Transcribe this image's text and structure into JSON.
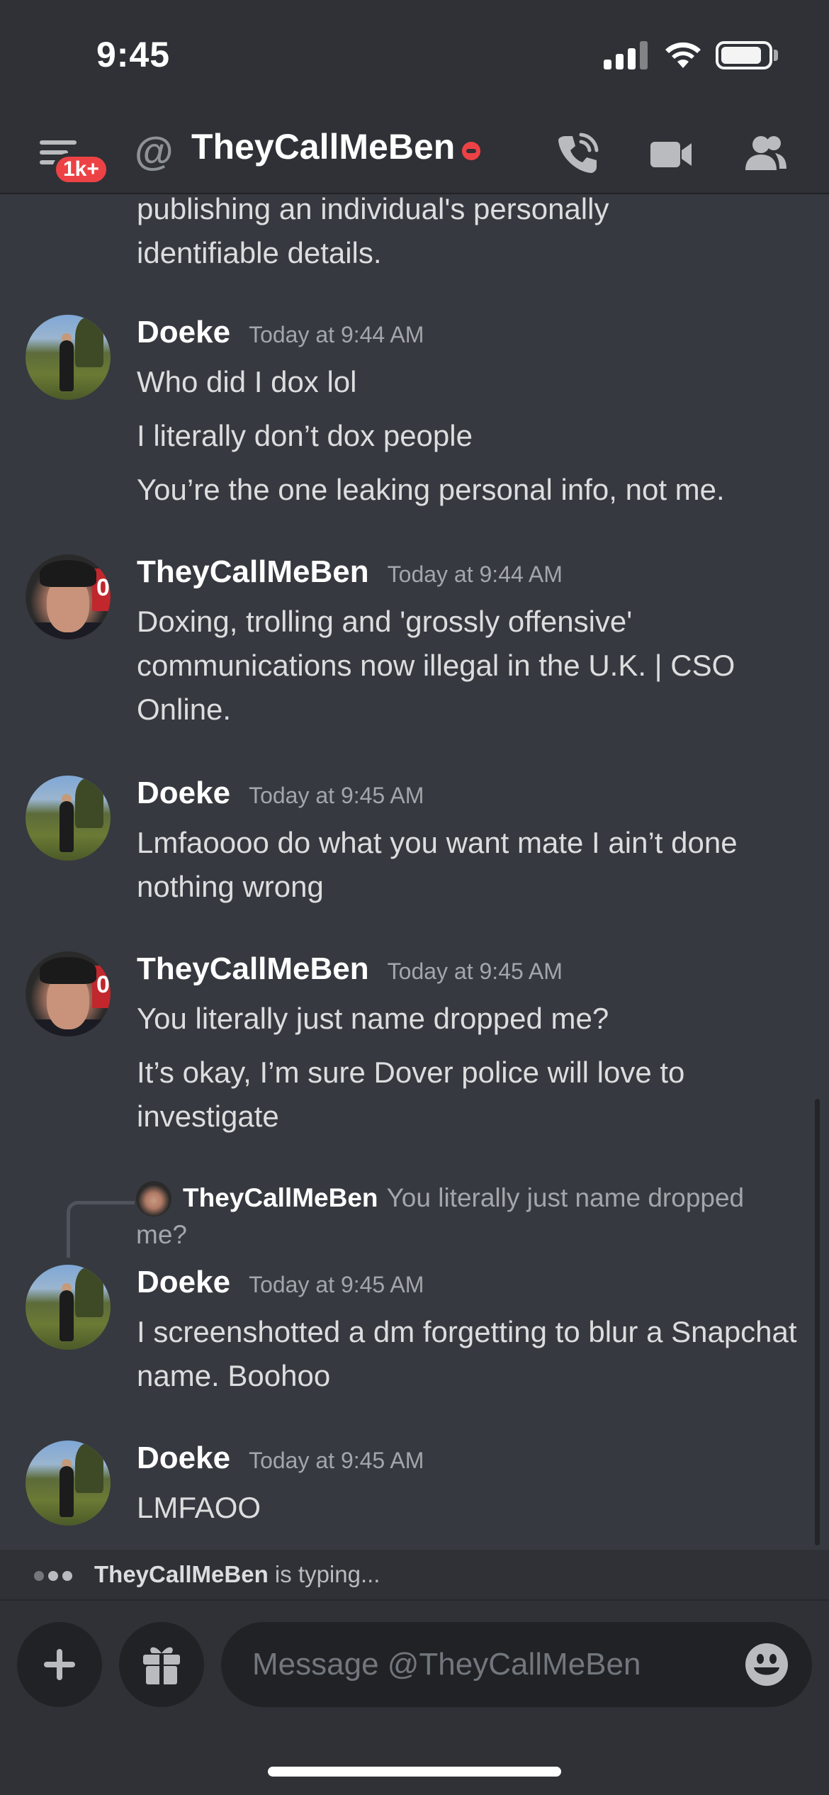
{
  "status_bar": {
    "time": "9:45"
  },
  "header": {
    "badge": "1k+",
    "at_symbol": "@",
    "title": "TheyCallMeBen"
  },
  "partial_message": {
    "lines": [
      "publishing an individual's personally",
      "identifiable details."
    ]
  },
  "messages": [
    {
      "author": "Doeke",
      "time": "Today at 9:44 AM",
      "lines": [
        "Who did I dox lol",
        "I literally don’t dox people",
        "You’re the one leaking personal info, not me."
      ]
    },
    {
      "author": "TheyCallMeBen",
      "time": "Today at 9:44 AM",
      "lines": [
        "Doxing, trolling and 'grossly offensive' communications now illegal in the U.K. | CSO Online."
      ]
    },
    {
      "author": "Doeke",
      "time": "Today at 9:45 AM",
      "lines": [
        "Lmfaoooo do what you want mate I ain’t done nothing wrong"
      ]
    },
    {
      "author": "TheyCallMeBen",
      "time": "Today at 9:45 AM",
      "lines": [
        "You literally just name dropped me?",
        "It’s okay, I’m sure Dover police will love to investigate"
      ]
    },
    {
      "author": "Doeke",
      "time": "Today at 9:45 AM",
      "reply": {
        "author": "TheyCallMeBen",
        "text": "You literally just name dropped me?"
      },
      "lines": [
        "I screenshotted a dm forgetting to blur a Snapchat name. Boohoo"
      ]
    },
    {
      "author": "Doeke",
      "time": "Today at 9:45 AM",
      "lines": [
        "LMFAOO"
      ]
    }
  ],
  "typing": {
    "user": "TheyCallMeBen",
    "suffix": " is typing..."
  },
  "composer": {
    "placeholder": "Message @TheyCallMeBen"
  },
  "icons": {
    "menu": "hamburger-icon",
    "call": "phone-call-icon",
    "video": "video-camera-icon",
    "members": "members-icon",
    "add": "plus-icon",
    "gift": "gift-icon",
    "emoji": "emoji-icon"
  },
  "colors": {
    "dnd_status": "#ed4245",
    "background": "#36393f",
    "header": "#2f3136"
  }
}
